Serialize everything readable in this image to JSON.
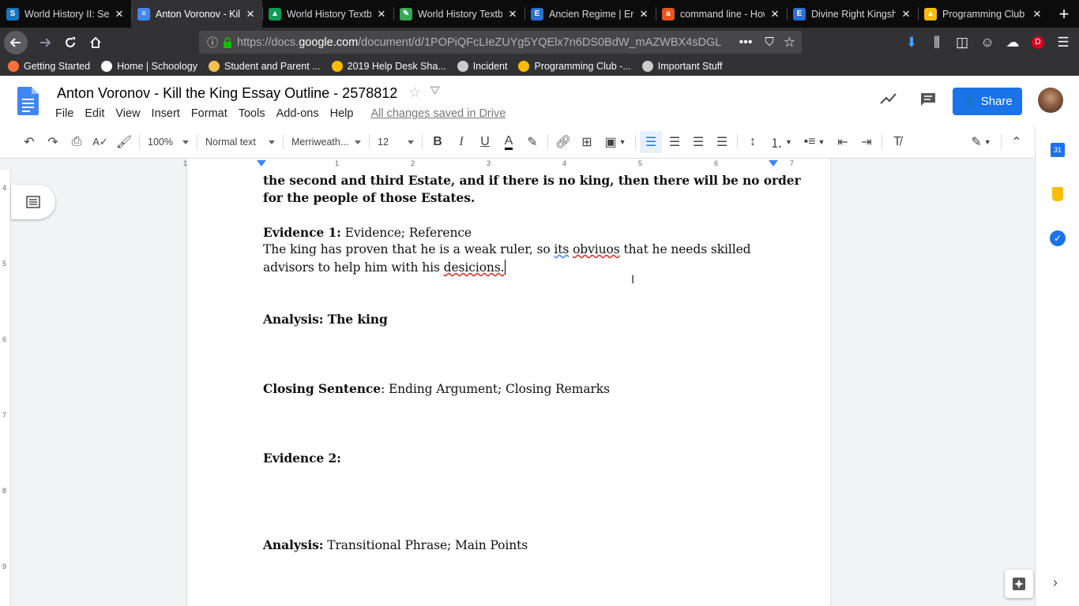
{
  "browser": {
    "tabs": [
      {
        "title": "World History II: Sec",
        "icon": "schoology-icon",
        "color": "#1b75bc",
        "letter": "S"
      },
      {
        "title": "Anton Voronov - Kill",
        "icon": "docs-icon",
        "color": "#4285f4",
        "letter": "≡"
      },
      {
        "title": "World History Textbo",
        "icon": "drive-icon",
        "color": "#0f9d58",
        "letter": "▲"
      },
      {
        "title": "World History Textbo",
        "icon": "pen-icon",
        "color": "#34a853",
        "letter": "✎"
      },
      {
        "title": "Ancien Regime | Enc",
        "icon": "britannica-icon",
        "color": "#2b6fd6",
        "letter": "E"
      },
      {
        "title": "command line - How",
        "icon": "askubuntu-icon",
        "color": "#e95420",
        "letter": "a"
      },
      {
        "title": "Divine Right Kingshi",
        "icon": "britannica-icon",
        "color": "#2b6fd6",
        "letter": "E"
      },
      {
        "title": "Programming Club -",
        "icon": "drive-icon",
        "color": "#fbbc04",
        "letter": "▲"
      }
    ],
    "url_prefix": "https://docs.",
    "url_host": "google.com",
    "url_rest": "/document/d/1POPiQFcLIeZUYg5YQElx7n6DS0BdW_mAZWBX4sDGL",
    "bookmarks": [
      {
        "label": "Getting Started",
        "icon": "firefox-icon",
        "color": "#ff7139"
      },
      {
        "label": "Home | Schoology",
        "icon": "schoology-icon",
        "color": "#ffffff"
      },
      {
        "label": "Student and Parent ...",
        "icon": "p-icon",
        "color": "#f2c14e"
      },
      {
        "label": "2019 Help Desk Sha...",
        "icon": "drive-icon",
        "color": "#fbbc04"
      },
      {
        "label": "Incident",
        "icon": "globe-icon",
        "color": "#cccccc"
      },
      {
        "label": "Programming Club -...",
        "icon": "drive-icon",
        "color": "#fbbc04"
      },
      {
        "label": "Important Stuff",
        "icon": "folder-icon",
        "color": "#cccccc"
      }
    ],
    "account_letter": "D"
  },
  "docs": {
    "title": "Anton Voronov - Kill the King Essay Outline - 2578812",
    "menus": [
      "File",
      "Edit",
      "View",
      "Insert",
      "Format",
      "Tools",
      "Add-ons",
      "Help"
    ],
    "save_status": "All changes saved in Drive",
    "share_label": "Share",
    "toolbar": {
      "zoom": "100%",
      "style": "Normal text",
      "font": "Merriweath...",
      "size": "12"
    },
    "ruler_marks": [
      "1",
      "1",
      "2",
      "3",
      "4",
      "5",
      "6",
      "7"
    ],
    "vruler_marks": [
      "4",
      "5",
      "6",
      "7",
      "8",
      "9"
    ]
  },
  "content": {
    "l1": "the second and third Estate, and if there is no king, then there will be no order",
    "l2": "for the people of those Estates.",
    "ev1_label": "Evidence 1:",
    "ev1_text": " Evidence; Reference",
    "body_a": "The king has proven that he is a weak ruler, so ",
    "body_its": "its",
    "body_sp": " ",
    "body_obv": "obviuos",
    "body_b": " that he needs skilled",
    "body2_a": "advisors to help him with his ",
    "body2_dec": "desicions.",
    "analysis1": "Analysis: The king",
    "closing_label": "Closing Sentence",
    "closing_text": ": Ending Argument; Closing Remarks",
    "ev2_label": "Evidence 2:",
    "analysis2_label": "Analysis:",
    "analysis2_text": " Transitional Phrase; Main Points"
  }
}
